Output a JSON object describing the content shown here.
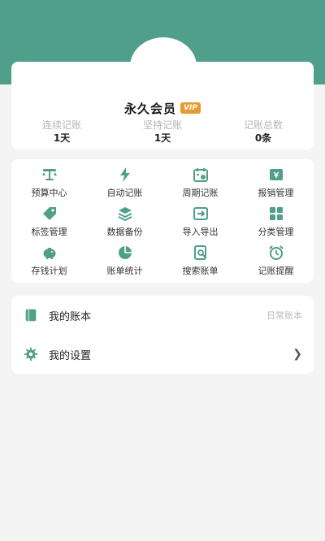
{
  "colors": {
    "accent": "#4f9f8a",
    "vip": "#e59b2e"
  },
  "profile": {
    "member_title": "永久会员",
    "vip_badge": "VIP",
    "stats": [
      {
        "label": "连续记账",
        "value": "1天"
      },
      {
        "label": "坚持记账",
        "value": "1天"
      },
      {
        "label": "记账总数",
        "value": "0条"
      }
    ]
  },
  "menu": {
    "items": [
      {
        "label": "预算中心",
        "icon": "scale-icon"
      },
      {
        "label": "自动记账",
        "icon": "lightning-icon"
      },
      {
        "label": "周期记账",
        "icon": "calendar-icon"
      },
      {
        "label": "报销管理",
        "icon": "reimburse-icon"
      },
      {
        "label": "标签管理",
        "icon": "tag-icon"
      },
      {
        "label": "数据备份",
        "icon": "layers-icon"
      },
      {
        "label": "导入导出",
        "icon": "import-export-icon"
      },
      {
        "label": "分类管理",
        "icon": "grid-icon"
      },
      {
        "label": "存钱计划",
        "icon": "piggy-bank-icon"
      },
      {
        "label": "账单统计",
        "icon": "pie-chart-icon"
      },
      {
        "label": "搜索账单",
        "icon": "search-document-icon"
      },
      {
        "label": "记账提醒",
        "icon": "alarm-clock-icon"
      }
    ]
  },
  "list": {
    "account_book_label": "我的账本",
    "account_book_value": "日常账本",
    "settings_label": "我的设置"
  }
}
